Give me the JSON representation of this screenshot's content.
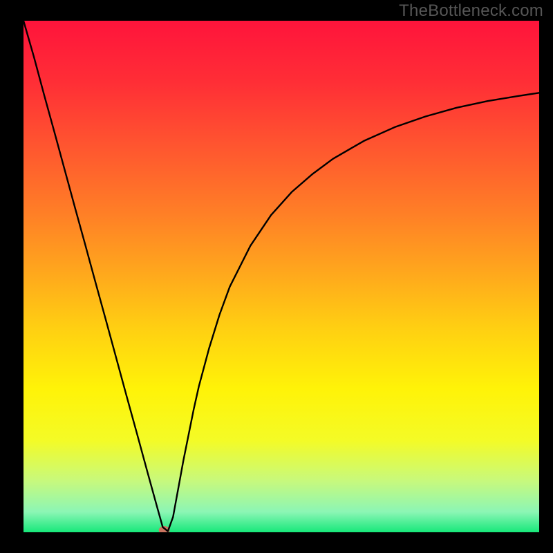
{
  "watermark": "TheBottleneck.com",
  "chart_data": {
    "type": "line",
    "title": "",
    "xlabel": "",
    "ylabel": "",
    "xlim": [
      0,
      100
    ],
    "ylim": [
      0,
      100
    ],
    "background_gradient": {
      "stops": [
        {
          "offset": 0.0,
          "color": "#ff143b"
        },
        {
          "offset": 0.12,
          "color": "#ff2e36"
        },
        {
          "offset": 0.25,
          "color": "#ff572f"
        },
        {
          "offset": 0.38,
          "color": "#ff8026"
        },
        {
          "offset": 0.5,
          "color": "#ffaa1c"
        },
        {
          "offset": 0.6,
          "color": "#ffcf12"
        },
        {
          "offset": 0.72,
          "color": "#fff308"
        },
        {
          "offset": 0.82,
          "color": "#f4fb26"
        },
        {
          "offset": 0.9,
          "color": "#c7f97d"
        },
        {
          "offset": 0.96,
          "color": "#8cf6b5"
        },
        {
          "offset": 1.0,
          "color": "#17e87a"
        }
      ]
    },
    "series": [
      {
        "name": "bottleneck-curve",
        "x": [
          0,
          2,
          4,
          6,
          8,
          10,
          12,
          14,
          16,
          18,
          20,
          22,
          24,
          26,
          27,
          28,
          29,
          30,
          31,
          32,
          33,
          34,
          36,
          38,
          40,
          44,
          48,
          52,
          56,
          60,
          66,
          72,
          78,
          84,
          90,
          96,
          100
        ],
        "values": [
          100,
          93,
          85.5,
          78.2,
          70.8,
          63.4,
          56.1,
          48.7,
          41.4,
          34.0,
          26.6,
          19.3,
          11.9,
          4.6,
          1.0,
          0.2,
          3.0,
          8.5,
          14.0,
          19.0,
          24.0,
          28.5,
          36.0,
          42.5,
          48.0,
          56.0,
          62.0,
          66.5,
          70.0,
          73.0,
          76.5,
          79.2,
          81.3,
          83.0,
          84.3,
          85.3,
          85.9
        ]
      }
    ],
    "marker": {
      "name": "optimal-point",
      "x": 27.3,
      "y": 0.4,
      "color": "#cb7560",
      "rx": 8,
      "ry": 6
    },
    "frame": {
      "border_color": "#000000",
      "border_width_left": 34,
      "border_width_right": 20,
      "border_width_top": 30,
      "border_width_bottom": 30
    }
  }
}
